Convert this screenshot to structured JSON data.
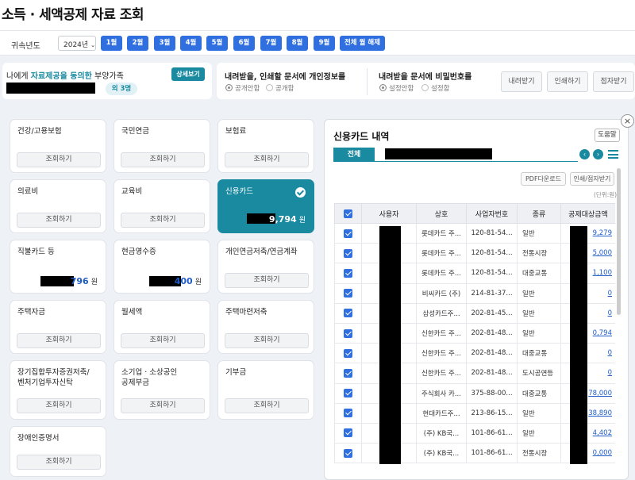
{
  "page": {
    "title": "소득 · 세액공제 자료 조회"
  },
  "year_bar": {
    "label": "귀속년도",
    "year_value": "2024년",
    "months": [
      "1월",
      "2월",
      "3월",
      "4월",
      "5월",
      "6월",
      "7월",
      "8월",
      "9월"
    ],
    "all_months_clear": "전체 월 해제"
  },
  "consent": {
    "text_prefix": "나에게 ",
    "text_highlight": "자료제공을 동의한",
    "text_suffix": " 부양가족",
    "detail_button": "상세보기",
    "others_count": "외 3명"
  },
  "personal_info": {
    "title": "내려받을, 인쇄할 문서에 개인정보를",
    "options": [
      "공개안함",
      "공개함"
    ],
    "selected": "공개안함"
  },
  "password": {
    "title": "내려받을 문서에 비밀번호를",
    "options": [
      "설정안함",
      "설정함"
    ],
    "selected": "설정안함"
  },
  "actions": {
    "download": "내려받기",
    "print": "인쇄하기",
    "accessibility": "점자받기"
  },
  "query_label": "조회하기",
  "categories": [
    {
      "title": "건강/고용보험",
      "mode": "query"
    },
    {
      "title": "국민연금",
      "mode": "query"
    },
    {
      "title": "보험료",
      "mode": "query"
    },
    {
      "title": "의료비",
      "mode": "query"
    },
    {
      "title": "교육비",
      "mode": "query"
    },
    {
      "title": "신용카드",
      "mode": "amount",
      "amount_visible": "9,794",
      "unit": "원",
      "active": true
    },
    {
      "title": "직불카드 등",
      "mode": "amount",
      "amount_visible": "796",
      "unit": "원"
    },
    {
      "title": "현금영수증",
      "mode": "amount",
      "amount_visible": "400",
      "unit": "원"
    },
    {
      "title": "개인연금저축/연금계좌",
      "mode": "query"
    },
    {
      "title": "주택자금",
      "mode": "query"
    },
    {
      "title": "월세액",
      "mode": "query"
    },
    {
      "title": "주택마련저축",
      "mode": "query"
    },
    {
      "title": "장기집합투자증권저축/\n벤처기업투자신탁",
      "mode": "query"
    },
    {
      "title": "소기업 · 소상공인\n공제부금",
      "mode": "query"
    },
    {
      "title": "기부금",
      "mode": "query"
    },
    {
      "title": "장애인증명서",
      "mode": "query"
    }
  ],
  "detail_panel": {
    "title": "신용카드 내역",
    "help_button": "도움말",
    "tab_all": "전체",
    "nav_prev": "‹",
    "nav_next": "›",
    "pdf_button": "PDF다운로드",
    "print_button": "인쇄/점자받기",
    "unit_note": "(단위:원)",
    "close_glyph": "×",
    "columns": [
      "사용자",
      "상호",
      "사업자번호",
      "종류",
      "공제대상금액"
    ],
    "rows": [
      {
        "store": "롯데카드 주...",
        "biz": "120-81-54...",
        "type": "일반",
        "amount": "9,279"
      },
      {
        "store": "롯데카드 주...",
        "biz": "120-81-54...",
        "type": "전통시장",
        "amount": "5,000"
      },
      {
        "store": "롯데카드 주...",
        "biz": "120-81-54...",
        "type": "대중교통",
        "amount": "1,100"
      },
      {
        "store": "비씨카드 (주)",
        "biz": "214-81-37...",
        "type": "일반",
        "amount": "0"
      },
      {
        "store": "삼성카드주...",
        "biz": "202-81-45...",
        "type": "일반",
        "amount": "0"
      },
      {
        "store": "신한카드 주...",
        "biz": "202-81-48...",
        "type": "일반",
        "amount": "0,794"
      },
      {
        "store": "신한카드 주...",
        "biz": "202-81-48...",
        "type": "대중교통",
        "amount": "0"
      },
      {
        "store": "신한카드 주...",
        "biz": "202-81-48...",
        "type": "도시공연등",
        "amount": "0"
      },
      {
        "store": "주식회사 카...",
        "biz": "375-88-00...",
        "type": "대중교통",
        "amount": "78,000"
      },
      {
        "store": "현대카드주...",
        "biz": "213-86-15...",
        "type": "일반",
        "amount": "38,890"
      },
      {
        "store": "(주) KB국...",
        "biz": "101-86-61...",
        "type": "일반",
        "amount": "4,402"
      },
      {
        "store": "(주) KB국...",
        "biz": "101-86-61...",
        "type": "전통시장",
        "amount": "0,000"
      }
    ]
  }
}
